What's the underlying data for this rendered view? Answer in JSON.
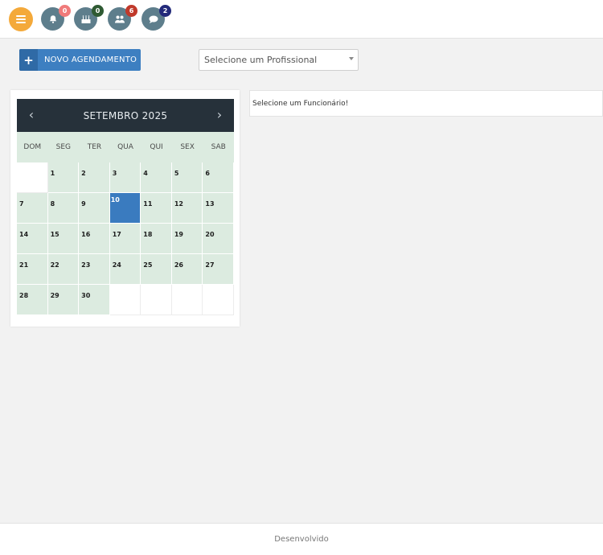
{
  "colors": {
    "accent_blue": "#3d7fc1",
    "menu_orange": "#f4a93a",
    "calendar_header": "#26313a",
    "calendar_day_bg": "#dcebe0",
    "selected_day": "#3a7bbf"
  },
  "topbar": {
    "menu_icon": "hamburger-menu-icon",
    "icons": [
      {
        "name": "bell-icon",
        "badge": "0",
        "badge_color": "#f07a7a"
      },
      {
        "name": "birthday-cake-icon",
        "badge": "0",
        "badge_color": "#2f5a33"
      },
      {
        "name": "users-icon",
        "badge": "6",
        "badge_color": "#c0392b"
      },
      {
        "name": "chat-bubble-icon",
        "badge": "2",
        "badge_color": "#232a7a"
      }
    ]
  },
  "actions": {
    "new_button_label": "NOVO AGENDAMENTO",
    "professional_select": "Selecione um Profissional"
  },
  "calendar": {
    "title": "SETEMBRO 2025",
    "days_of_week": [
      "DOM",
      "SEG",
      "TER",
      "QUA",
      "QUI",
      "SEX",
      "SAB"
    ],
    "leading_empty": 1,
    "days_in_month": 30,
    "selected_day": 10
  },
  "info_panel": {
    "message": "Selecione um Funcionário!"
  },
  "footer": {
    "text": "Desenvolvido"
  }
}
